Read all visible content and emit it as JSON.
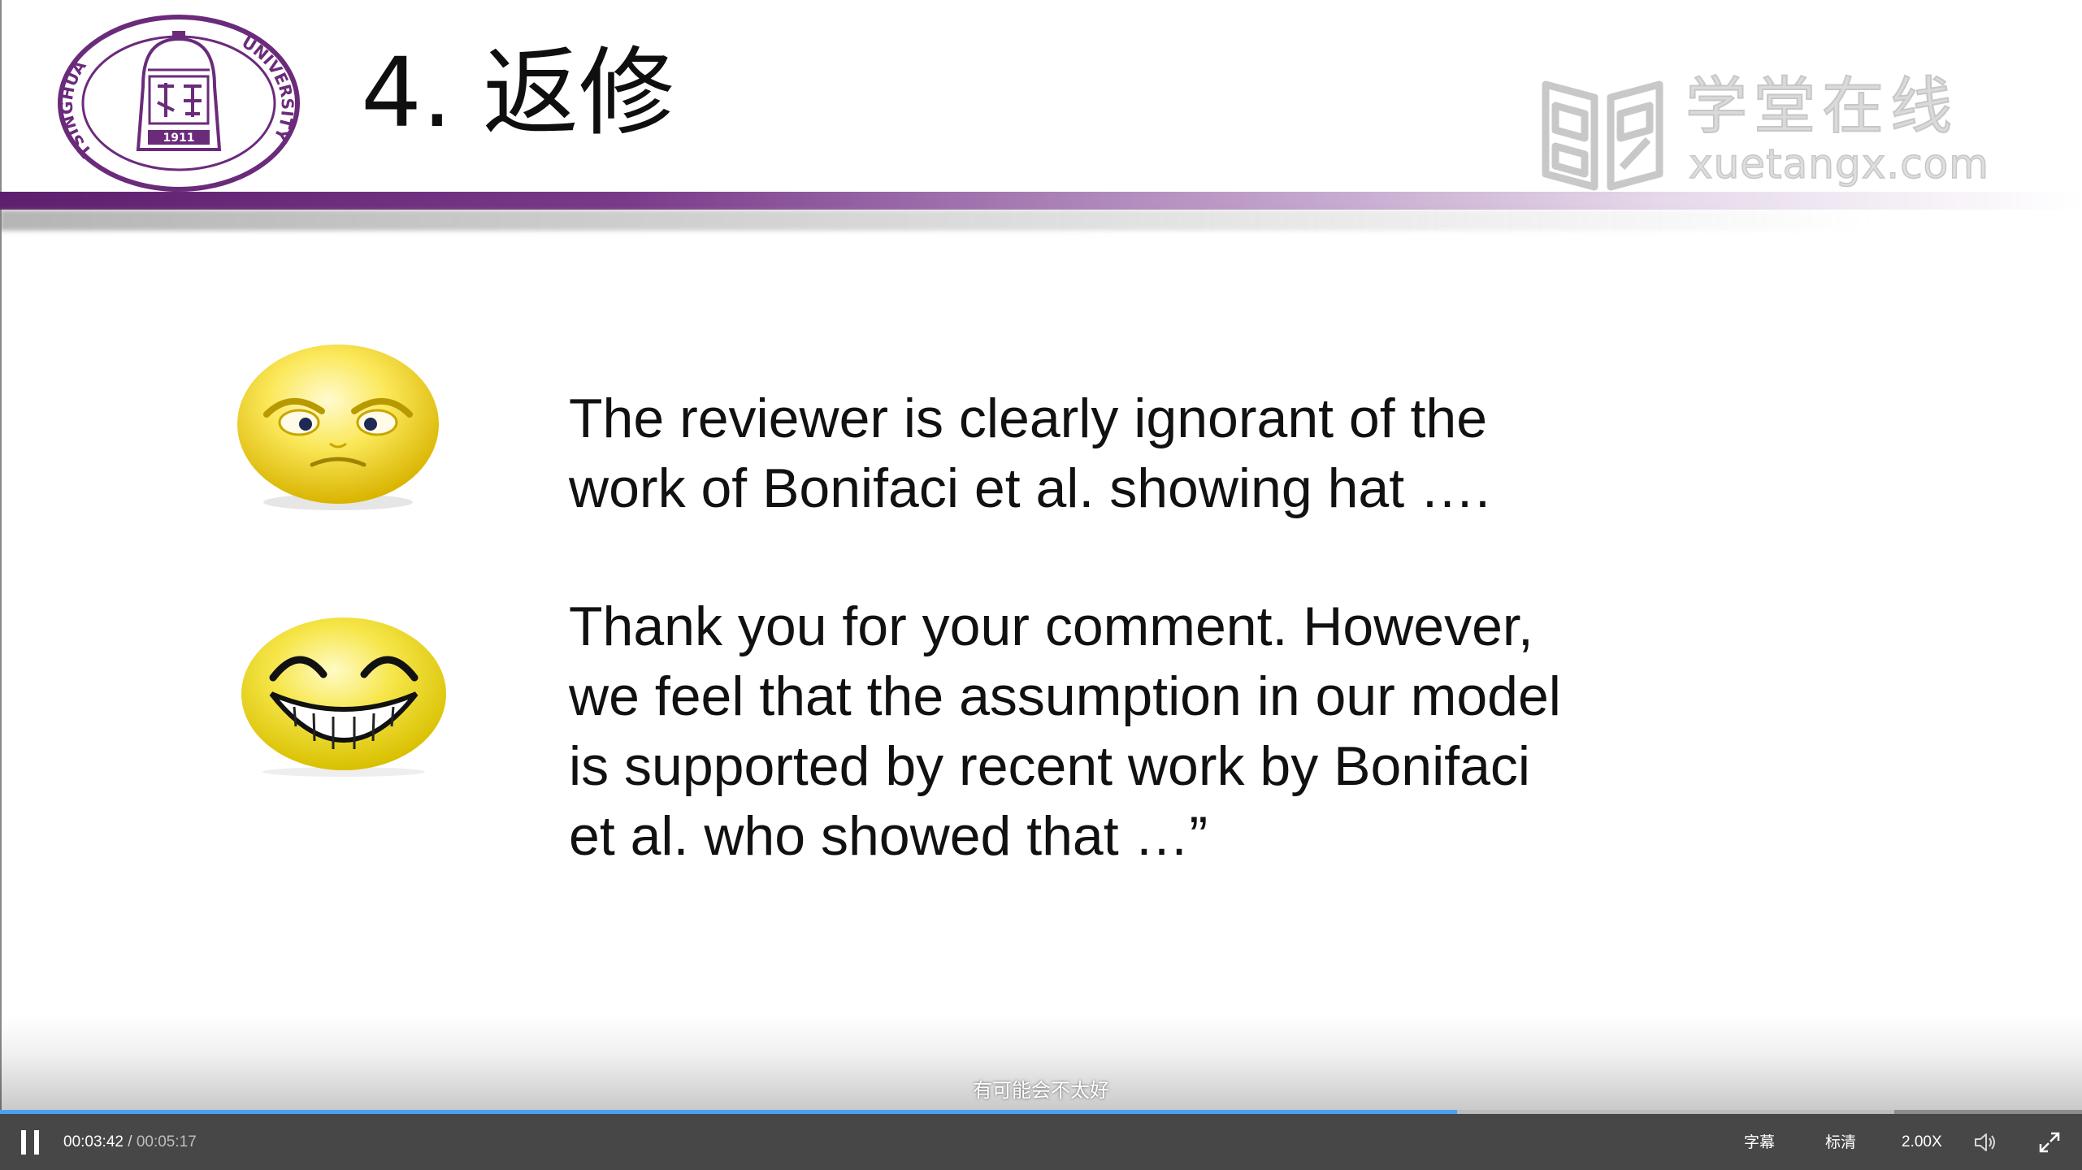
{
  "slide": {
    "title": "4. 返修",
    "logo": {
      "name": "tsinghua-university-seal",
      "text_top": "TSINGHUA UNIVERSITY",
      "year": "1911"
    },
    "watermark": {
      "cn": "学堂在线",
      "en": "xuetangx.com"
    },
    "accent_color": "#6b2b7b",
    "blocks": [
      {
        "emoji": "angry-face",
        "lines": [
          "The reviewer is clearly ignorant of the",
          "work of Bonifaci et al. showing hat …."
        ]
      },
      {
        "emoji": "grinning-face",
        "lines": [
          "Thank you for your comment. However,",
          "we feel that the assumption in our model",
          "is supported by recent work by Bonifaci",
          "et al. who showed that …”"
        ]
      }
    ]
  },
  "player": {
    "subtitle": "有可能会不太好",
    "current_time": "00:03:42",
    "time_separator": "/",
    "total_time": "00:05:17",
    "played_fraction": 0.7,
    "buffered_fraction": 0.91,
    "state_icon": "pause-icon",
    "subtitles_label": "字幕",
    "quality_label": "标清",
    "speed_label": "2.00X",
    "volume_icon": "volume-icon",
    "fullscreen_icon": "fullscreen-icon",
    "progress_color": "#4aa3f0",
    "bar_color": "#474747"
  }
}
